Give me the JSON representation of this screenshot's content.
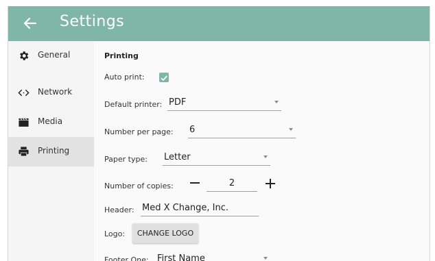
{
  "colors": {
    "header": "#7fb6a8",
    "accent": "#7fb6a8"
  },
  "header": {
    "title": "Settings",
    "back_icon": "arrow-left-icon"
  },
  "sidebar": {
    "items": [
      {
        "label": "General",
        "icon": "gear-icon"
      },
      {
        "label": "Network",
        "icon": "code-arrows-icon"
      },
      {
        "label": "Media",
        "icon": "clapperboard-icon"
      },
      {
        "label": "Printing",
        "icon": "printer-icon",
        "selected": true
      }
    ]
  },
  "main": {
    "section_title": "Printing",
    "auto_print": {
      "label": "Auto print:",
      "checked": true
    },
    "default_printer": {
      "label": "Default printer:",
      "value": "PDF"
    },
    "number_per_page": {
      "label": "Number per page:",
      "value": "6"
    },
    "paper_type": {
      "label": "Paper type:",
      "value": "Letter"
    },
    "copies": {
      "label": "Number of copies:",
      "value": "2",
      "decrement": "−",
      "increment": "+"
    },
    "header_field": {
      "label": "Header:",
      "value": "Med X Change, Inc."
    },
    "logo": {
      "label": "Logo:",
      "button": "CHANGE LOGO"
    },
    "footer_one": {
      "label": "Footer One:",
      "value": "First Name"
    }
  }
}
